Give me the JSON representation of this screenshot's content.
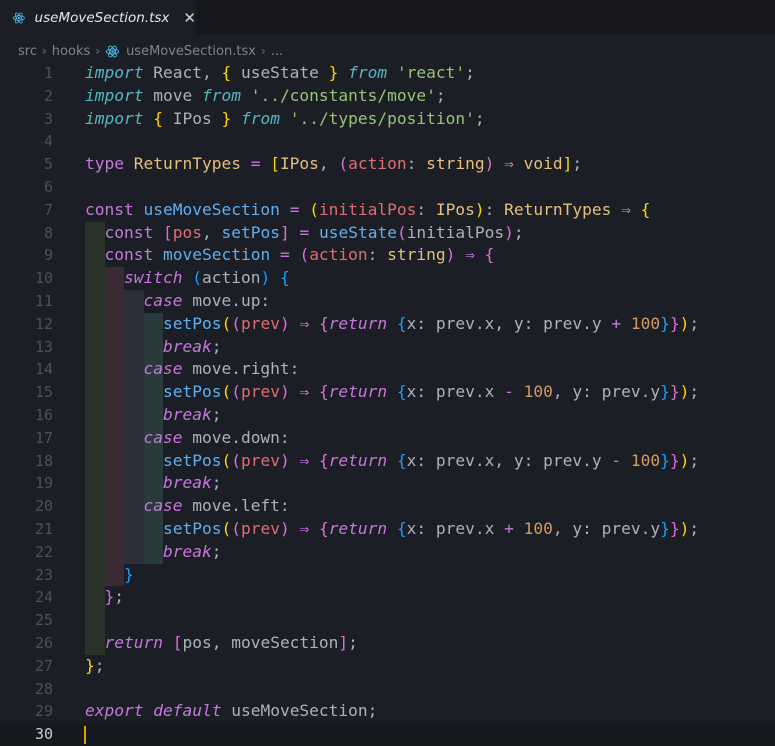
{
  "tab": {
    "label": "useMoveSection.tsx",
    "close": "✕",
    "icon": "react-icon"
  },
  "breadcrumb": {
    "items": [
      "src",
      "hooks",
      "useMoveSection.tsx",
      "..."
    ],
    "separator": "›"
  },
  "editor": {
    "active_line": 30,
    "colors": {
      "background": "#1b1e24",
      "line_number": "#495162",
      "cursor": "#d7a600",
      "keyword": "#c678dd",
      "type": "#e5c07b",
      "string": "#98c379",
      "function": "#61afef",
      "variable": "#e06c75",
      "number": "#d19a66"
    },
    "lines": [
      {
        "n": "1",
        "tokens": [
          [
            "kw2",
            "import"
          ],
          [
            "plain",
            " React, "
          ],
          [
            "b1",
            "{"
          ],
          [
            "plain",
            " useState "
          ],
          [
            "b1",
            "}"
          ],
          [
            "plain",
            " "
          ],
          [
            "kw2",
            "from"
          ],
          [
            "plain",
            " "
          ],
          [
            "str",
            "'react'"
          ],
          [
            "plain",
            ";"
          ]
        ]
      },
      {
        "n": "2",
        "tokens": [
          [
            "kw2",
            "import"
          ],
          [
            "plain",
            " move "
          ],
          [
            "kw2",
            "from"
          ],
          [
            "plain",
            " "
          ],
          [
            "str",
            "'../constants/move'"
          ],
          [
            "plain",
            ";"
          ]
        ]
      },
      {
        "n": "3",
        "tokens": [
          [
            "kw2",
            "import"
          ],
          [
            "plain",
            " "
          ],
          [
            "b1",
            "{"
          ],
          [
            "plain",
            " IPos "
          ],
          [
            "b1",
            "}"
          ],
          [
            "plain",
            " "
          ],
          [
            "kw2",
            "from"
          ],
          [
            "plain",
            " "
          ],
          [
            "str",
            "'../types/position'"
          ],
          [
            "plain",
            ";"
          ]
        ]
      },
      {
        "n": "4",
        "tokens": []
      },
      {
        "n": "5",
        "tokens": [
          [
            "tk",
            "type"
          ],
          [
            "plain",
            " "
          ],
          [
            "typ",
            "ReturnTypes"
          ],
          [
            "plain",
            " "
          ],
          [
            "op",
            "="
          ],
          [
            "plain",
            " "
          ],
          [
            "b1",
            "["
          ],
          [
            "typ",
            "IPos"
          ],
          [
            "plain",
            ", "
          ],
          [
            "b2",
            "("
          ],
          [
            "var",
            "action"
          ],
          [
            "plain",
            ": "
          ],
          [
            "typ",
            "string"
          ],
          [
            "b2",
            ")"
          ],
          [
            "plain",
            " "
          ],
          [
            "op",
            "⇒"
          ],
          [
            "plain",
            " "
          ],
          [
            "typ",
            "void"
          ],
          [
            "b1",
            "]"
          ],
          [
            "plain",
            ";"
          ]
        ]
      },
      {
        "n": "6",
        "tokens": []
      },
      {
        "n": "7",
        "tokens": [
          [
            "tk",
            "const"
          ],
          [
            "plain",
            " "
          ],
          [
            "fn",
            "useMoveSection"
          ],
          [
            "plain",
            " "
          ],
          [
            "op",
            "="
          ],
          [
            "plain",
            " "
          ],
          [
            "b1",
            "("
          ],
          [
            "var",
            "initialPos"
          ],
          [
            "plain",
            ": "
          ],
          [
            "typ",
            "IPos"
          ],
          [
            "b1",
            ")"
          ],
          [
            "plain",
            ": "
          ],
          [
            "typ",
            "ReturnTypes"
          ],
          [
            "plain",
            " "
          ],
          [
            "op",
            "⇒"
          ],
          [
            "plain",
            " "
          ],
          [
            "b1",
            "{"
          ]
        ]
      },
      {
        "n": "8",
        "tokens": [
          [
            "plain",
            "  "
          ],
          [
            "tk",
            "const"
          ],
          [
            "plain",
            " "
          ],
          [
            "b2",
            "["
          ],
          [
            "var",
            "pos"
          ],
          [
            "plain",
            ", "
          ],
          [
            "fn",
            "setPos"
          ],
          [
            "b2",
            "]"
          ],
          [
            "plain",
            " "
          ],
          [
            "op",
            "="
          ],
          [
            "plain",
            " "
          ],
          [
            "fn",
            "useState"
          ],
          [
            "b2",
            "("
          ],
          [
            "plain",
            "initialPos"
          ],
          [
            "b2",
            ")"
          ],
          [
            "plain",
            ";"
          ]
        ]
      },
      {
        "n": "9",
        "tokens": [
          [
            "plain",
            "  "
          ],
          [
            "tk",
            "const"
          ],
          [
            "plain",
            " "
          ],
          [
            "fn",
            "moveSection"
          ],
          [
            "plain",
            " "
          ],
          [
            "op",
            "="
          ],
          [
            "plain",
            " "
          ],
          [
            "b2",
            "("
          ],
          [
            "var",
            "action"
          ],
          [
            "plain",
            ": "
          ],
          [
            "typ",
            "string"
          ],
          [
            "b2",
            ")"
          ],
          [
            "plain",
            " "
          ],
          [
            "op",
            "⇒"
          ],
          [
            "plain",
            " "
          ],
          [
            "b2",
            "{"
          ]
        ]
      },
      {
        "n": "10",
        "tokens": [
          [
            "plain",
            "    "
          ],
          [
            "kw",
            "switch"
          ],
          [
            "plain",
            " "
          ],
          [
            "b3",
            "("
          ],
          [
            "plain",
            "action"
          ],
          [
            "b3",
            ")"
          ],
          [
            "plain",
            " "
          ],
          [
            "b3",
            "{"
          ]
        ]
      },
      {
        "n": "11",
        "tokens": [
          [
            "plain",
            "      "
          ],
          [
            "kw",
            "case"
          ],
          [
            "plain",
            " move.up:"
          ]
        ]
      },
      {
        "n": "12",
        "tokens": [
          [
            "plain",
            "        "
          ],
          [
            "fn",
            "setPos"
          ],
          [
            "b1",
            "("
          ],
          [
            "b2",
            "("
          ],
          [
            "var",
            "prev"
          ],
          [
            "b2",
            ")"
          ],
          [
            "plain",
            " "
          ],
          [
            "op",
            "⇒"
          ],
          [
            "plain",
            " "
          ],
          [
            "b2",
            "{"
          ],
          [
            "kw",
            "return"
          ],
          [
            "plain",
            " "
          ],
          [
            "b3",
            "{"
          ],
          [
            "plain",
            "x: prev.x, y: prev.y "
          ],
          [
            "op",
            "+"
          ],
          [
            "plain",
            " "
          ],
          [
            "num",
            "100"
          ],
          [
            "b3",
            "}"
          ],
          [
            "b2",
            "}"
          ],
          [
            "b1",
            ")"
          ],
          [
            "plain",
            ";"
          ]
        ]
      },
      {
        "n": "13",
        "tokens": [
          [
            "plain",
            "        "
          ],
          [
            "kw",
            "break"
          ],
          [
            "plain",
            ";"
          ]
        ]
      },
      {
        "n": "14",
        "tokens": [
          [
            "plain",
            "      "
          ],
          [
            "kw",
            "case"
          ],
          [
            "plain",
            " move.right:"
          ]
        ]
      },
      {
        "n": "15",
        "tokens": [
          [
            "plain",
            "        "
          ],
          [
            "fn",
            "setPos"
          ],
          [
            "b1",
            "("
          ],
          [
            "b2",
            "("
          ],
          [
            "var",
            "prev"
          ],
          [
            "b2",
            ")"
          ],
          [
            "plain",
            " "
          ],
          [
            "op",
            "⇒"
          ],
          [
            "plain",
            " "
          ],
          [
            "b2",
            "{"
          ],
          [
            "kw",
            "return"
          ],
          [
            "plain",
            " "
          ],
          [
            "b3",
            "{"
          ],
          [
            "plain",
            "x: prev.x "
          ],
          [
            "op",
            "-"
          ],
          [
            "plain",
            " "
          ],
          [
            "num",
            "100"
          ],
          [
            "plain",
            ", y: prev.y"
          ],
          [
            "b3",
            "}"
          ],
          [
            "b2",
            "}"
          ],
          [
            "b1",
            ")"
          ],
          [
            "plain",
            ";"
          ]
        ]
      },
      {
        "n": "16",
        "tokens": [
          [
            "plain",
            "        "
          ],
          [
            "kw",
            "break"
          ],
          [
            "plain",
            ";"
          ]
        ]
      },
      {
        "n": "17",
        "tokens": [
          [
            "plain",
            "      "
          ],
          [
            "kw",
            "case"
          ],
          [
            "plain",
            " move.down:"
          ]
        ]
      },
      {
        "n": "18",
        "tokens": [
          [
            "plain",
            "        "
          ],
          [
            "fn",
            "setPos"
          ],
          [
            "b1",
            "("
          ],
          [
            "b2",
            "("
          ],
          [
            "var",
            "prev"
          ],
          [
            "b2",
            ")"
          ],
          [
            "plain",
            " "
          ],
          [
            "op",
            "⇒"
          ],
          [
            "plain",
            " "
          ],
          [
            "b2",
            "{"
          ],
          [
            "kw",
            "return"
          ],
          [
            "plain",
            " "
          ],
          [
            "b3",
            "{"
          ],
          [
            "plain",
            "x: prev.x, y: prev.y "
          ],
          [
            "op",
            "-"
          ],
          [
            "plain",
            " "
          ],
          [
            "num",
            "100"
          ],
          [
            "b3",
            "}"
          ],
          [
            "b2",
            "}"
          ],
          [
            "b1",
            ")"
          ],
          [
            "plain",
            ";"
          ]
        ]
      },
      {
        "n": "19",
        "tokens": [
          [
            "plain",
            "        "
          ],
          [
            "kw",
            "break"
          ],
          [
            "plain",
            ";"
          ]
        ]
      },
      {
        "n": "20",
        "tokens": [
          [
            "plain",
            "      "
          ],
          [
            "kw",
            "case"
          ],
          [
            "plain",
            " move.left:"
          ]
        ]
      },
      {
        "n": "21",
        "tokens": [
          [
            "plain",
            "        "
          ],
          [
            "fn",
            "setPos"
          ],
          [
            "b1",
            "("
          ],
          [
            "b2",
            "("
          ],
          [
            "var",
            "prev"
          ],
          [
            "b2",
            ")"
          ],
          [
            "plain",
            " "
          ],
          [
            "op",
            "⇒"
          ],
          [
            "plain",
            " "
          ],
          [
            "b2",
            "{"
          ],
          [
            "kw",
            "return"
          ],
          [
            "plain",
            " "
          ],
          [
            "b3",
            "{"
          ],
          [
            "plain",
            "x: prev.x "
          ],
          [
            "op",
            "+"
          ],
          [
            "plain",
            " "
          ],
          [
            "num",
            "100"
          ],
          [
            "plain",
            ", y: prev.y"
          ],
          [
            "b3",
            "}"
          ],
          [
            "b2",
            "}"
          ],
          [
            "b1",
            ")"
          ],
          [
            "plain",
            ";"
          ]
        ]
      },
      {
        "n": "22",
        "tokens": [
          [
            "plain",
            "        "
          ],
          [
            "kw",
            "break"
          ],
          [
            "plain",
            ";"
          ]
        ]
      },
      {
        "n": "23",
        "tokens": [
          [
            "plain",
            "    "
          ],
          [
            "b3",
            "}"
          ]
        ]
      },
      {
        "n": "24",
        "tokens": [
          [
            "plain",
            "  "
          ],
          [
            "b2",
            "}"
          ],
          [
            "plain",
            ";"
          ]
        ]
      },
      {
        "n": "25",
        "tokens": []
      },
      {
        "n": "26",
        "tokens": [
          [
            "plain",
            "  "
          ],
          [
            "kw",
            "return"
          ],
          [
            "plain",
            " "
          ],
          [
            "b2",
            "["
          ],
          [
            "plain",
            "pos, moveSection"
          ],
          [
            "b2",
            "]"
          ],
          [
            "plain",
            ";"
          ]
        ]
      },
      {
        "n": "27",
        "tokens": [
          [
            "b1",
            "}"
          ],
          [
            "plain",
            ";"
          ]
        ]
      },
      {
        "n": "28",
        "tokens": []
      },
      {
        "n": "29",
        "tokens": [
          [
            "kw",
            "export"
          ],
          [
            "plain",
            " "
          ],
          [
            "kw",
            "default"
          ],
          [
            "plain",
            " useMoveSection;"
          ]
        ]
      },
      {
        "n": "30",
        "tokens": []
      }
    ]
  }
}
